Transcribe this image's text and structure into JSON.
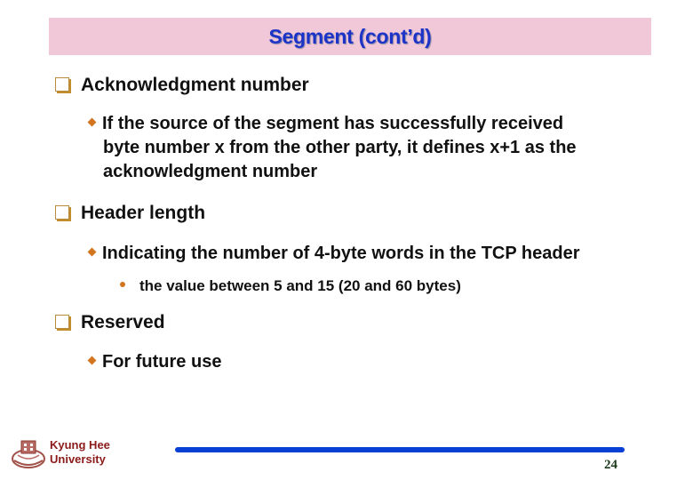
{
  "slide": {
    "title": "Segment (cont’d)",
    "page_number": "24",
    "colors": {
      "title_background": "#f1c8d8",
      "title_text": "#1c33c7",
      "bullet_accent": "#d3751e",
      "footer_bar": "#0a3fd6",
      "university_text": "#8b1a1a"
    }
  },
  "sections": [
    {
      "heading": "Acknowledgment number",
      "icon": "checkbox-bullet-icon",
      "items": [
        {
          "text_lines": [
            "If the source of the segment has successfully received",
            "byte number x from the other party, it defines x+1 as the",
            "acknowledgment number"
          ],
          "icon": "diamond-bullet-icon"
        }
      ]
    },
    {
      "heading": "Header length",
      "icon": "checkbox-bullet-icon",
      "items": [
        {
          "text": "Indicating the number of 4-byte words in the TCP header",
          "icon": "diamond-bullet-icon",
          "subitems": [
            {
              "text": "the value between 5 and 15 (20 and 60 bytes)",
              "icon": "dot-bullet-icon"
            }
          ]
        }
      ]
    },
    {
      "heading": "Reserved",
      "icon": "checkbox-bullet-icon",
      "items": [
        {
          "text": "For future use",
          "icon": "diamond-bullet-icon"
        }
      ]
    }
  ],
  "footer": {
    "university_line1": "Kyung Hee",
    "university_line2": "University",
    "logo_icon": "university-crest-icon"
  }
}
